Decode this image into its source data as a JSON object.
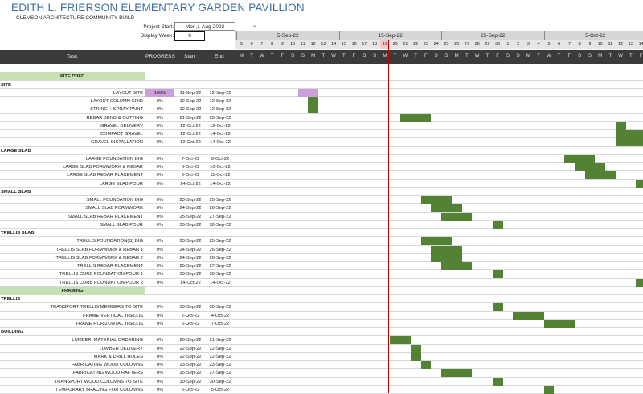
{
  "title": "EDITH L. FRIERSON ELEMENTARY GARDEN PAVILLION",
  "subtitle": "CLEMSON ARCHITECTURE COMMUNITY BUILD",
  "project_start_label": "Project Start:",
  "project_start_value": "Mon,1-Aug-2022",
  "display_week_label": "Display Week:",
  "display_week_value": "6",
  "scroll_glyph": "═",
  "weeks": [
    "5-Sep-22",
    "15-Sep-22",
    "25-Sep-22",
    "5-Oct-22"
  ],
  "day_numbers": [
    "5",
    "6",
    "7",
    "8",
    "9",
    "10",
    "11",
    "12",
    "13",
    "14",
    "15",
    "16",
    "17",
    "18",
    "19",
    "20",
    "21",
    "22",
    "23",
    "24",
    "25",
    "26",
    "27",
    "28",
    "29",
    "30",
    "1",
    "2",
    "3",
    "4",
    "5",
    "6",
    "7",
    "8",
    "9",
    "10",
    "11",
    "12",
    "13",
    "14"
  ],
  "day_letters": [
    "M",
    "T",
    "W",
    "T",
    "F",
    "S",
    "S",
    "M",
    "T",
    "W",
    "T",
    "F",
    "S",
    "S",
    "M",
    "T",
    "W",
    "T",
    "F",
    "S",
    "S",
    "M",
    "T",
    "W",
    "T",
    "F",
    "S",
    "S",
    "M",
    "T",
    "W",
    "T",
    "F",
    "S",
    "S",
    "M",
    "T",
    "W",
    "T",
    "F"
  ],
  "today_day": "19",
  "header": {
    "task": "Task",
    "progress": "PROGRESS",
    "start": "Start",
    "end": "End"
  },
  "rows": [
    {
      "type": "blank"
    },
    {
      "type": "phase",
      "task": "SITE PREP"
    },
    {
      "type": "section",
      "task": "SITE"
    },
    {
      "type": "task",
      "task": "LAYOUT SITE",
      "progress": "100%",
      "start": "11-Sep-22",
      "end": "12-Sep-22",
      "done": true
    },
    {
      "type": "task",
      "task": "LAYOUT COLUMN GRID",
      "progress": "0%",
      "start": "12-Sep-22",
      "end": "12-Sep-22"
    },
    {
      "type": "task",
      "task": "STRING + SPRAY PAINT",
      "progress": "0%",
      "start": "12-Sep-22",
      "end": "12-Sep-22"
    },
    {
      "type": "task",
      "task": "REBAR BEND & CUTTING",
      "progress": "0%",
      "start": "21-Sep-22",
      "end": "23-Sep-22"
    },
    {
      "type": "task",
      "task": "GRAVEL DELIVERY",
      "progress": "0%",
      "start": "12-Oct-22",
      "end": "12-Oct-22"
    },
    {
      "type": "task",
      "task": "COMPACT GRAVEL",
      "progress": "0%",
      "start": "12-Oct-22",
      "end": "14-Oct-22"
    },
    {
      "type": "task",
      "task": "GRAVEL INSTALLATION",
      "progress": "0%",
      "start": "12-Oct-22",
      "end": "14-Oct-22"
    },
    {
      "type": "section",
      "task": "LARGE SLAB"
    },
    {
      "type": "task",
      "task": "LARGE FOUNDATION DIG",
      "progress": "0%",
      "start": "7-Oct-22",
      "end": "9-Oct-22"
    },
    {
      "type": "task",
      "task": "LARGE SLAB FORMWORK & REBAR",
      "progress": "0%",
      "start": "8-Oct-22",
      "end": "10-Oct-22"
    },
    {
      "type": "task",
      "task": "LARGE SLAB REBAR PLACEMENT",
      "progress": "0%",
      "start": "9-Oct-22",
      "end": "11-Oct-22"
    },
    {
      "type": "task",
      "task": "LARGE SLAB POUR",
      "progress": "0%",
      "start": "14-Oct-22",
      "end": "14-Oct-22"
    },
    {
      "type": "section",
      "task": "SMALL SLAB"
    },
    {
      "type": "task",
      "task": "SMALL FOUNDATION DIG",
      "progress": "0%",
      "start": "23-Sep-22",
      "end": "25-Sep-22"
    },
    {
      "type": "task",
      "task": "SMALL SLAB  FORMWORK",
      "progress": "0%",
      "start": "24-Sep-22",
      "end": "26-Sep-22"
    },
    {
      "type": "task",
      "task": "SMALL SLAB REBAR PLACEMENT",
      "progress": "0%",
      "start": "25-Sep-22",
      "end": "27-Sep-22"
    },
    {
      "type": "task",
      "task": "SMALL SLAB POUR",
      "progress": "0%",
      "start": "30-Sep-22",
      "end": "30-Sep-22"
    },
    {
      "type": "section",
      "task": "TRELLIS SLAB"
    },
    {
      "type": "task",
      "task": "TRELLIS FOUNDATION(S) DIG",
      "progress": "0%",
      "start": "23-Sep-22",
      "end": "25-Sep-22"
    },
    {
      "type": "task",
      "task": "TRELLIS SLAB FORMWORK  & REBAR 1",
      "progress": "0%",
      "start": "24-Sep-22",
      "end": "26-Sep-22"
    },
    {
      "type": "task",
      "task": "TRELLIS SLAB FORMWORK & REBAR 2",
      "progress": "0%",
      "start": "24-Sep-22",
      "end": "26-Sep-22"
    },
    {
      "type": "task",
      "task": "TRELLIS REBAR PLACEMENT",
      "progress": "0%",
      "start": "25-Sep-22",
      "end": "27-Sep-22"
    },
    {
      "type": "task",
      "task": "TRELLIS CURB FOUNDATION POUR 1",
      "progress": "0%",
      "start": "30-Sep-22",
      "end": "30-Sep-22"
    },
    {
      "type": "task",
      "task": "TRELLIS CURB FOUNDATION POUR 2",
      "progress": "0%",
      "start": "14-Oct-22",
      "end": "14-Oct-22"
    },
    {
      "type": "phase",
      "task": "FRAMING"
    },
    {
      "type": "section",
      "task": "TRELLIS"
    },
    {
      "type": "task",
      "task": "TRANSPORT TRELLIS MEMBERS TO SITE",
      "progress": "0%",
      "start": "30-Sep-22",
      "end": "30-Sep-22"
    },
    {
      "type": "task",
      "task": "FRAME VERTICAL TRELLIS",
      "progress": "0%",
      "start": "2-Oct-22",
      "end": "4-Oct-22"
    },
    {
      "type": "task",
      "task": "FRAME HORIZONTAL TRELLIS",
      "progress": "0%",
      "start": "5-Oct-22",
      "end": "7-Oct-22"
    },
    {
      "type": "section",
      "task": "BUILDING"
    },
    {
      "type": "task",
      "task": "LUMBER: MATERIAL ORDERING",
      "progress": "0%",
      "start": "20-Sep-22",
      "end": "21-Sep-22"
    },
    {
      "type": "task",
      "task": "LUMBER DELIVERY",
      "progress": "0%",
      "start": "22-Sep-22",
      "end": "22-Sep-22"
    },
    {
      "type": "task",
      "task": "MARK & DRILL HOLES",
      "progress": "0%",
      "start": "22-Sep-22",
      "end": "22-Sep-22"
    },
    {
      "type": "task",
      "task": "FABRICATING WOOD COLUMNS",
      "progress": "0%",
      "start": "23-Sep-22",
      "end": "23-Sep-22"
    },
    {
      "type": "task",
      "task": "FABRICATING WOOD RAFTERS",
      "progress": "0%",
      "start": "25-Sep-22",
      "end": "27-Sep-22"
    },
    {
      "type": "task",
      "task": "TRANSPORT WOOD COLUMNS TO SITE",
      "progress": "0%",
      "start": "30-Sep-22",
      "end": "30-Sep-22"
    },
    {
      "type": "task",
      "task": "TEMPORARY BRACING FOR COLUMNS",
      "progress": "0%",
      "start": "5-Oct-22",
      "end": "5-Oct-22"
    }
  ],
  "colors": {
    "bar": "#548235",
    "bar_done": "#c9a0dc",
    "phase": "#c6e0b4",
    "header": "#3b3b3b",
    "title": "#3e6fa3",
    "today": "#c00000"
  }
}
